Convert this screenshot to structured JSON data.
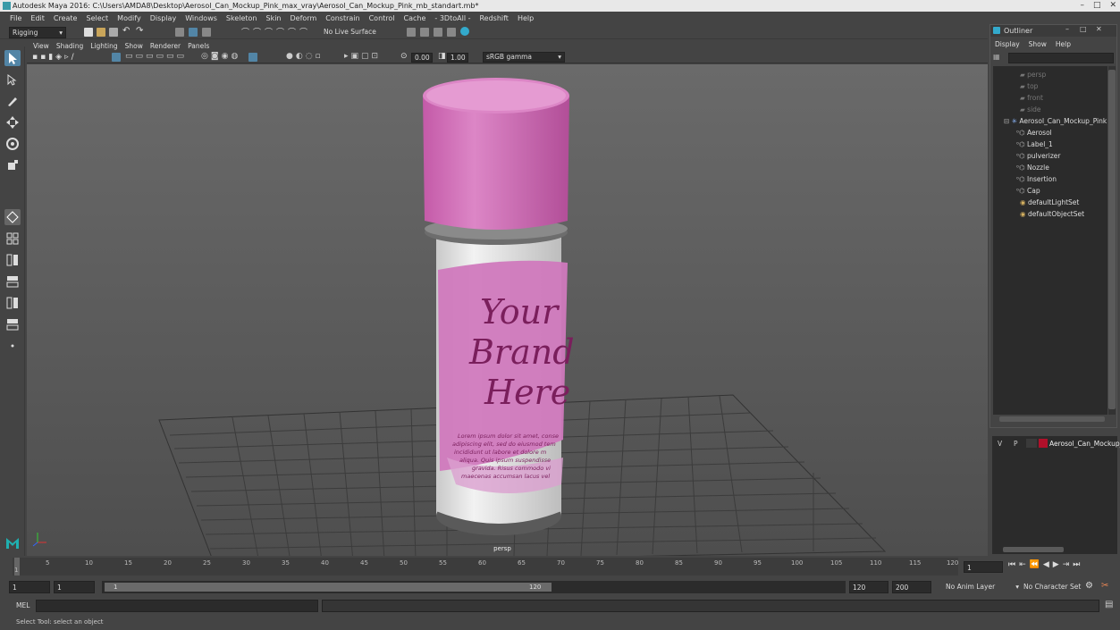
{
  "window": {
    "title": "Autodesk Maya 2016: C:\\Users\\AMDA8\\Desktop\\Aerosol_Can_Mockup_Pink_max_vray\\Aerosol_Can_Mockup_Pink_mb_standart.mb*",
    "controls": [
      "–",
      "□",
      "✕"
    ]
  },
  "menubar": [
    "File",
    "Edit",
    "Create",
    "Select",
    "Modify",
    "Display",
    "Windows",
    "Skeleton",
    "Skin",
    "Deform",
    "Constrain",
    "Control",
    "Cache",
    "- 3DtoAll -",
    "Redshift",
    "Help"
  ],
  "statusline": {
    "mode": "Rigging",
    "live_surface": "No Live Surface"
  },
  "panel_menu": [
    "View",
    "Shading",
    "Lighting",
    "Show",
    "Renderer",
    "Panels"
  ],
  "panel_toolbar": {
    "exposure": "0.00",
    "gamma": "1.00",
    "color_space": "sRGB gamma"
  },
  "viewport": {
    "camera": "persp",
    "label_text": [
      "Your",
      "Brand",
      "Here"
    ],
    "lorem": [
      "Lorem ipsum dolor sit amet, conse",
      "adipiscing elit, sed do eiusmod tem",
      "incididunt ut labore et dolore m",
      "aliqua. Quis ipsum suspendisse",
      "gravida. Risus commodo vi",
      "maecenas accumsan lacus vel"
    ]
  },
  "outliner": {
    "title": "Outliner",
    "menu": [
      "Display",
      "Show",
      "Help"
    ],
    "items": [
      {
        "label": "persp",
        "dim": true
      },
      {
        "label": "top",
        "dim": true
      },
      {
        "label": "front",
        "dim": true
      },
      {
        "label": "side",
        "dim": true
      },
      {
        "label": "Aerosol_Can_Mockup_Pink"
      },
      {
        "label": "Aerosol"
      },
      {
        "label": "Label_1"
      },
      {
        "label": "pulverizer"
      },
      {
        "label": "Nozzle"
      },
      {
        "label": "Insertion"
      },
      {
        "label": "Cap"
      },
      {
        "label": "defaultLightSet"
      },
      {
        "label": "defaultObjectSet"
      }
    ]
  },
  "layer_panel": {
    "v": "V",
    "p": "P",
    "layer_name": "Aerosol_Can_Mockup_",
    "layer_color": "#b0102a"
  },
  "timeline": {
    "ticks": [
      "5",
      "10",
      "15",
      "20",
      "25",
      "30",
      "35",
      "40",
      "45",
      "50",
      "55",
      "60",
      "65",
      "70",
      "75",
      "80",
      "85",
      "90",
      "95",
      "100",
      "105",
      "110",
      "115",
      "120"
    ],
    "start_tick": "1",
    "current_frame": "1"
  },
  "range": {
    "start": "1",
    "start2": "1",
    "range_start": "1",
    "range_end": "120",
    "end": "120",
    "end2": "200",
    "anim_layer": "No Anim Layer",
    "char_set": "No Character Set"
  },
  "mel": {
    "label": "MEL"
  },
  "help_line": "Select Tool: select an object",
  "colors": {
    "accent": "#5285a6",
    "viewport_bg": "#5e5e5e",
    "can_pink": "#d070b8",
    "brand_text": "#7a1f5c"
  }
}
